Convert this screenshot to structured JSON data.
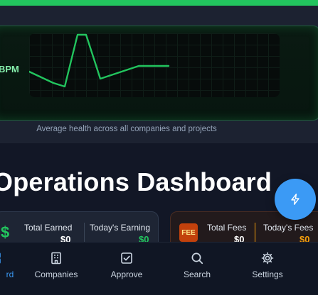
{
  "monitor": {
    "bpm_label": "BPM",
    "caption": "Average health across all companies and projects",
    "line_color": "#22c55e"
  },
  "page": {
    "title": "Operations Dashboard"
  },
  "fab": {
    "icon": "lightning-icon"
  },
  "earnings_card": {
    "icon": "dollar-icon",
    "total_earned_label": "Total Earned",
    "total_earned_value": "$0",
    "todays_earning_label": "Today's Earning",
    "todays_earning_value": "$0"
  },
  "fees_card": {
    "icon_text": "FEE",
    "total_fees_label": "Total Fees",
    "total_fees_value": "$0",
    "todays_fees_label": "Today's Fees",
    "todays_fees_value": "$0"
  },
  "nav": {
    "items": [
      {
        "label": "rd",
        "icon": "dashboard-icon",
        "active": true
      },
      {
        "label": "Companies",
        "icon": "building-icon"
      },
      {
        "label": "Approve",
        "icon": "checkbox-icon"
      },
      {
        "label": "Search",
        "icon": "search-icon"
      },
      {
        "label": "Settings",
        "icon": "gear-icon"
      }
    ]
  },
  "colors": {
    "accent": "#3b9af5",
    "success": "#22c55e",
    "warning": "#f59e0b",
    "background": "#121726"
  }
}
